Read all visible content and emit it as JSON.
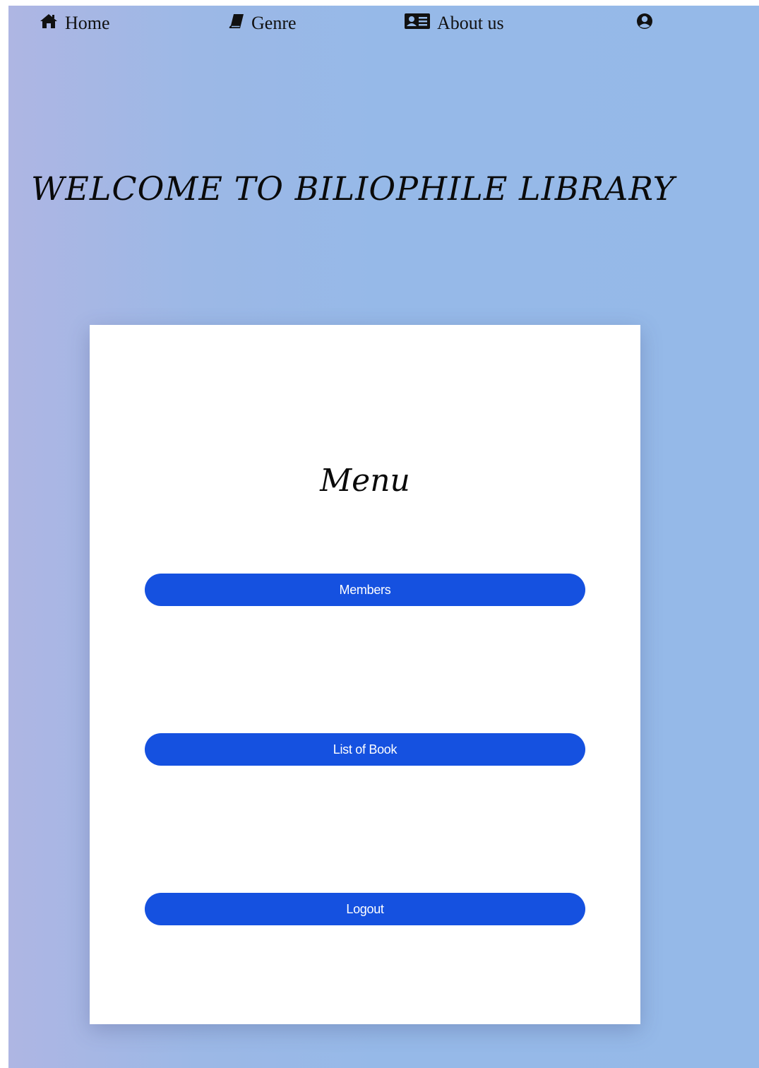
{
  "nav": {
    "home_label": "Home",
    "home_icon": "home-icon",
    "genre_label": "Genre",
    "genre_icon": "book-icon",
    "about_label": "About us",
    "about_icon": "id-card-icon",
    "user_icon": "user-circle-icon"
  },
  "welcome": {
    "heading": "WELCOME TO BILIOPHILE LIBRARY"
  },
  "menu": {
    "title": "Menu",
    "members_label": "Members",
    "books_label": "List of Book",
    "logout_label": "Logout"
  },
  "colors": {
    "button": "#1551e0",
    "background": "#95b9e8",
    "card": "#ffffff"
  }
}
